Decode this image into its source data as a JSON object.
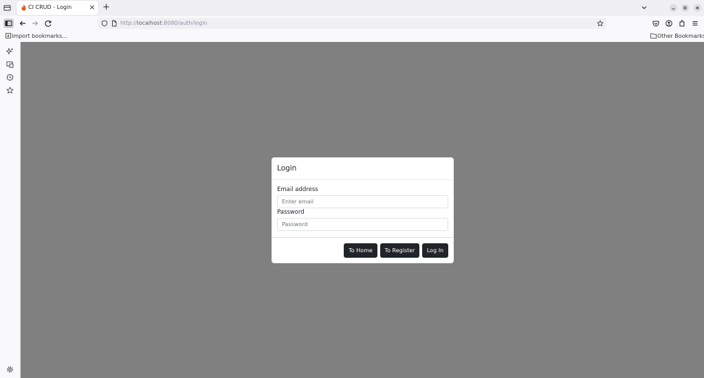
{
  "browser": {
    "tab_title": "CI CRUD - Login",
    "url_prefix": "http://",
    "url_host": "localhost",
    "url_rest": ":8080/auth/login",
    "bookmarks": {
      "import_label": "Import bookmarks...",
      "other_label": "Other Bookmarks"
    }
  },
  "login": {
    "title": "Login",
    "email_label": "Email address",
    "email_placeholder": "Enter email",
    "password_label": "Password",
    "password_placeholder": "Password",
    "buttons": {
      "home": "To Home",
      "register": "To Register",
      "login": "Log In"
    }
  },
  "colors": {
    "backdrop": "#808080",
    "button": "#212529",
    "favicon": "#e8571a"
  }
}
